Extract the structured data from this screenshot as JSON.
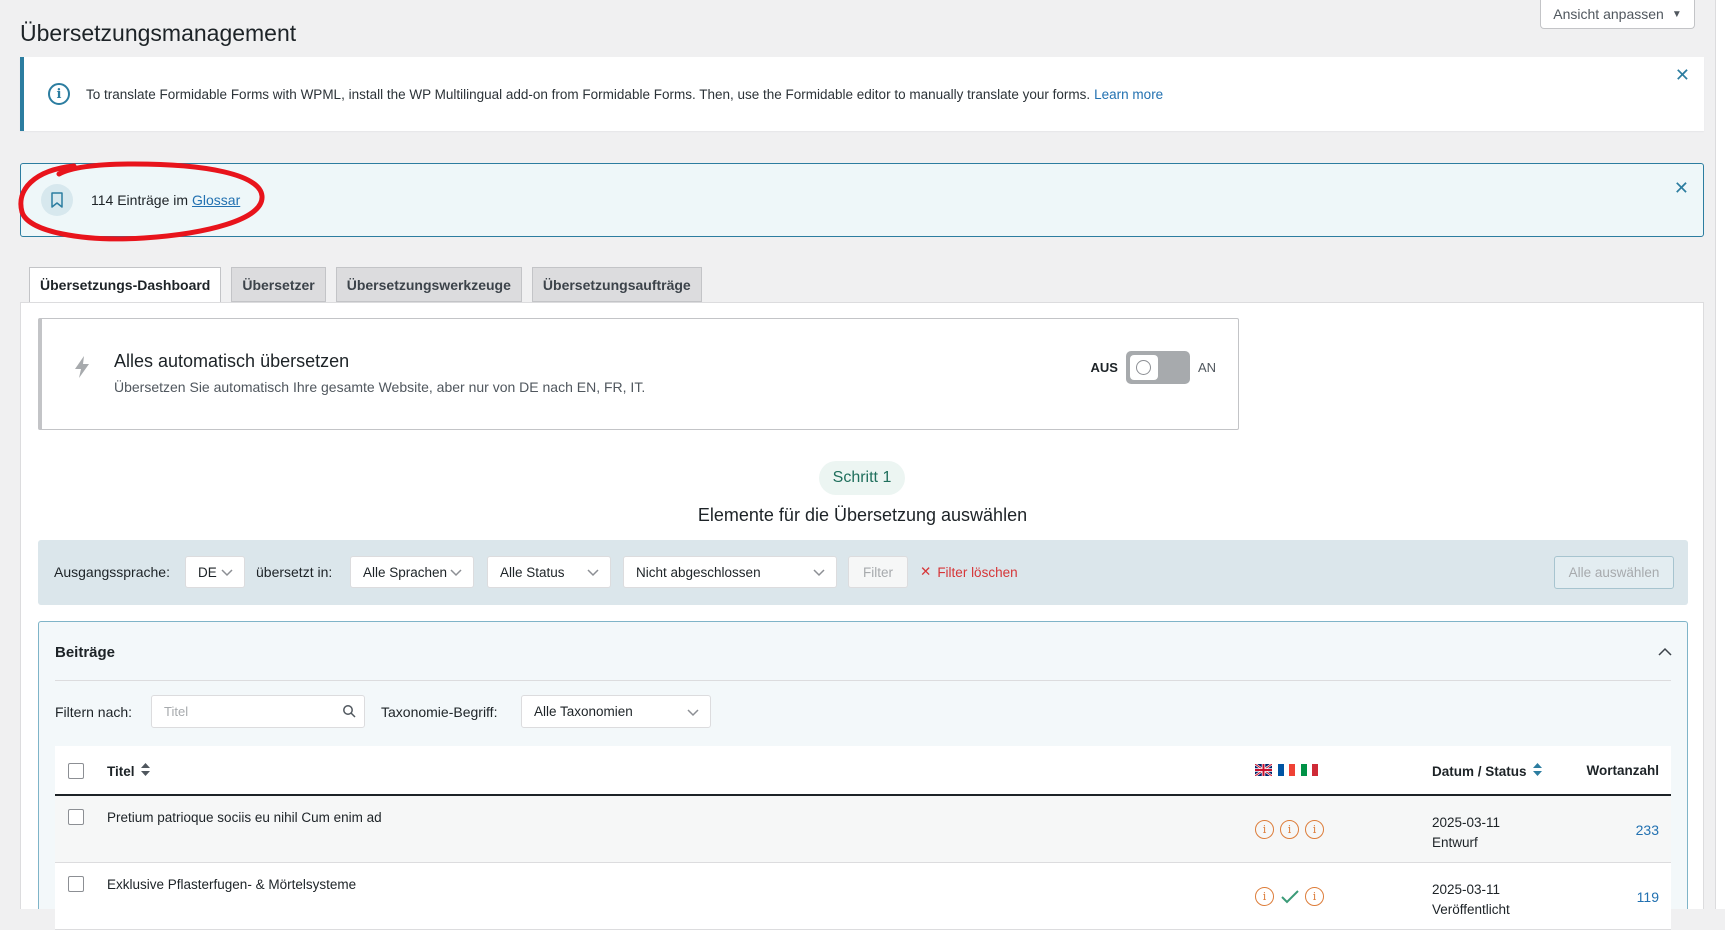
{
  "screen_options": {
    "label": "Ansicht anpassen"
  },
  "page": {
    "title": "Übersetzungsmanagement"
  },
  "notice_info": {
    "text": "To translate Formidable Forms with WPML, install the WP Multilingual add-on from Formidable Forms. Then, use the Formidable editor to manually translate your forms.",
    "link": "Learn more"
  },
  "notice_glossary": {
    "text": "114 Einträge im",
    "link": "Glossar"
  },
  "tabs": [
    {
      "label": "Übersetzungs-Dashboard"
    },
    {
      "label": "Übersetzer"
    },
    {
      "label": "Übersetzungswerkzeuge"
    },
    {
      "label": "Übersetzungsaufträge"
    }
  ],
  "auto_translate": {
    "title": "Alles automatisch übersetzen",
    "description": "Übersetzen Sie automatisch Ihre gesamte Website, aber nur von DE nach EN, FR, IT.",
    "off_label": "AUS",
    "on_label": "AN"
  },
  "step": {
    "pill": "Schritt 1",
    "heading": "Elemente für die Übersetzung auswählen"
  },
  "filter_bar": {
    "source_label": "Ausgangssprache:",
    "source_value": "DE",
    "translated_label": "übersetzt in:",
    "languages_value": "Alle Sprachen",
    "status_value": "Alle Status",
    "completion_value": "Nicht abgeschlossen",
    "filter_button": "Filter",
    "clear_button": "Filter löschen",
    "select_all_button": "Alle auswählen"
  },
  "posts": {
    "title": "Beiträge",
    "filter_label": "Filtern nach:",
    "search_placeholder": "Titel",
    "taxonomy_label": "Taxonomie-Begriff:",
    "taxonomy_value": "Alle Taxonomien",
    "columns": {
      "title": "Titel",
      "date_status": "Datum / Status",
      "word_count": "Wortanzahl"
    },
    "rows": [
      {
        "title": "Pretium patrioque sociis eu nihil Cum enim ad",
        "date": "2025-03-11",
        "status": "Entwurf",
        "words": "233",
        "langs": [
          "info",
          "info",
          "info"
        ]
      },
      {
        "title": "Exklusive Pflasterfugen- & Mörtelsysteme",
        "date": "2025-03-11",
        "status": "Veröffentlicht",
        "words": "119",
        "langs": [
          "info",
          "check",
          "info"
        ]
      }
    ]
  },
  "colors": {
    "accent": "#2c7da0",
    "link": "#2271b1",
    "warning": "#dd7d3a",
    "success": "#3b9b78",
    "danger": "#d63638",
    "annotation": "#e8141c"
  }
}
